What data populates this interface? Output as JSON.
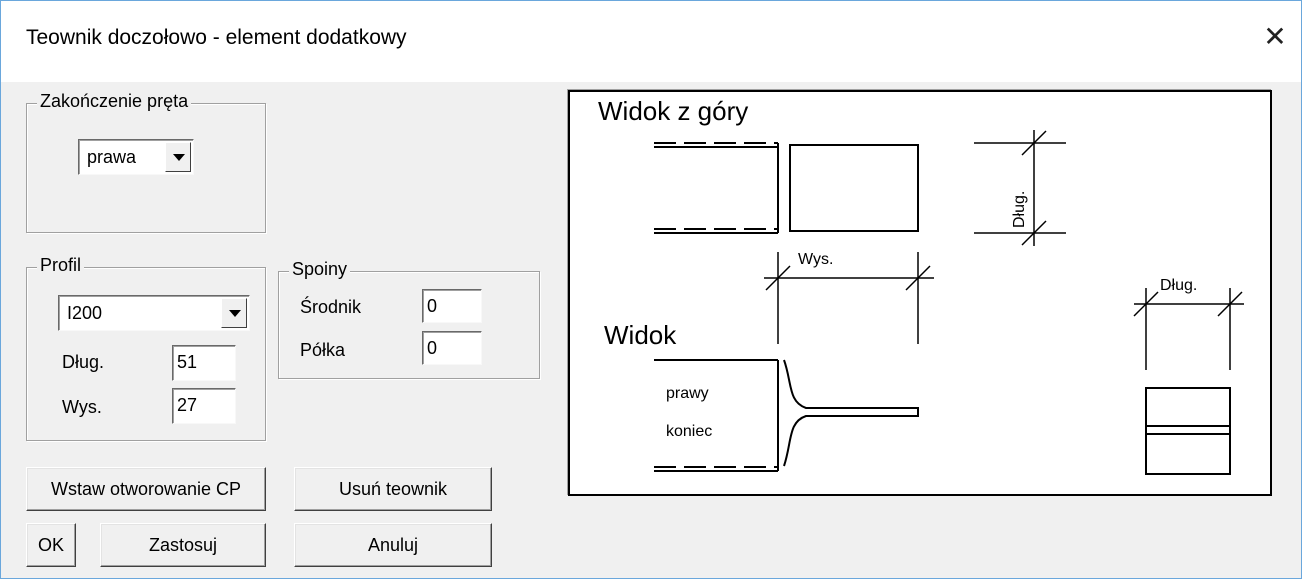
{
  "window": {
    "title": "Teownik doczołowo - element dodatkowy",
    "close_glyph": "✕"
  },
  "zakonczenie": {
    "legend": "Zakończenie pręta",
    "value": "prawa"
  },
  "profil": {
    "legend": "Profil",
    "value": "I200",
    "dlug_label": "Dług.",
    "dlug_value": "51",
    "wys_label": "Wys.",
    "wys_value": "27"
  },
  "spoiny": {
    "legend": "Spoiny",
    "srodnik_label": "Środnik",
    "srodnik_value": "0",
    "polka_label": "Półka",
    "polka_value": "0"
  },
  "buttons": {
    "wstaw": "Wstaw otworowanie CP",
    "usun": "Usuń teownik",
    "ok": "OK",
    "zastosuj": "Zastosuj",
    "anuluj": "Anuluj"
  },
  "preview": {
    "view_top": "Widok z góry",
    "view_side": "Widok",
    "dim_dlug_vertical": "Dług.",
    "dim_wys": "Wys.",
    "dim_dlug_side": "Dług.",
    "note_line1": "prawy",
    "note_line2": "koniec"
  }
}
